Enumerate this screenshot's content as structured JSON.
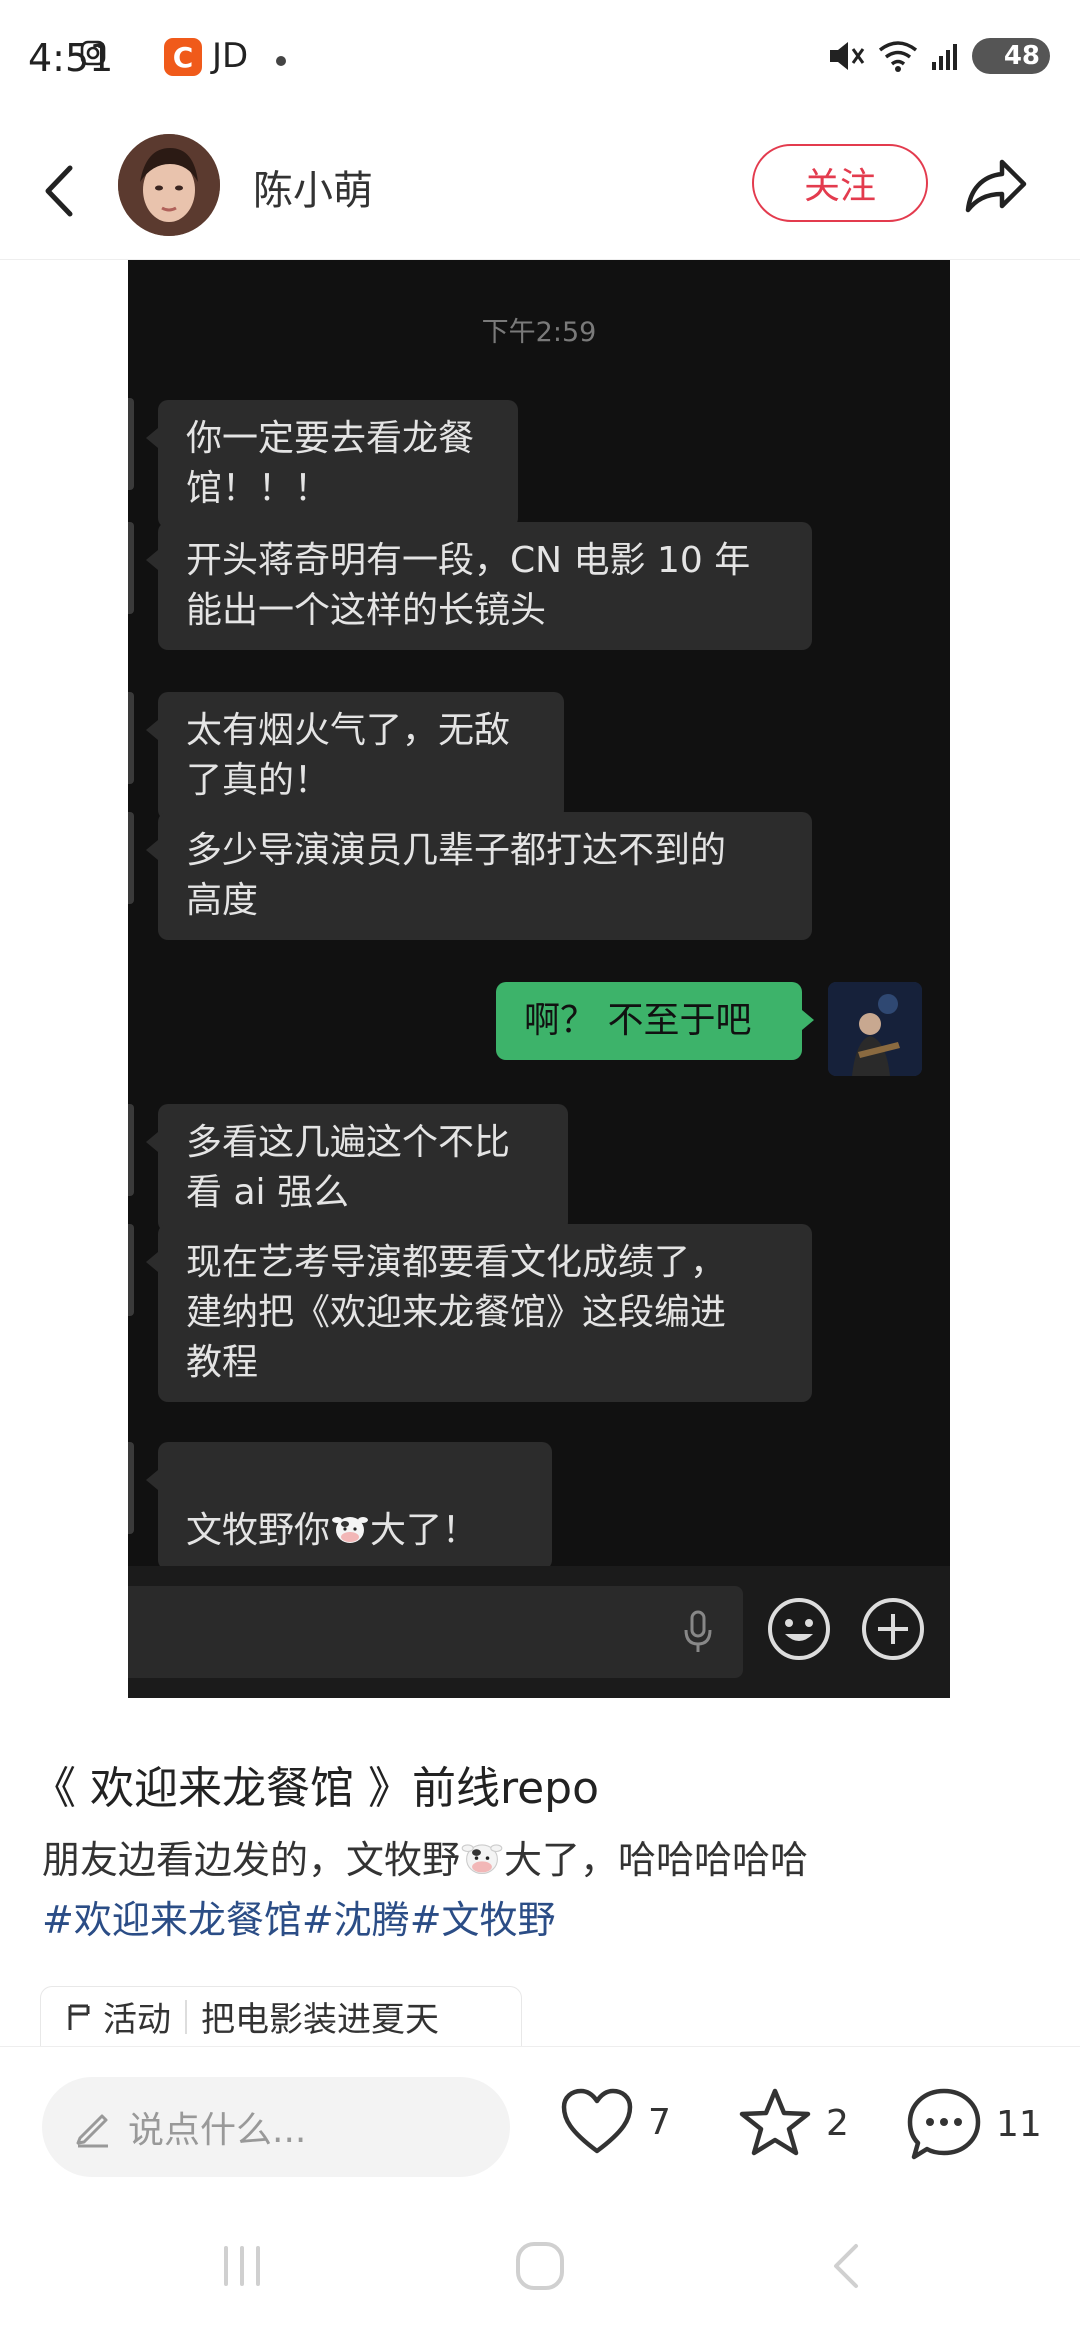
{
  "status_bar": {
    "time": "4:51",
    "app_badge": "C",
    "app_label": "JD",
    "battery": "48"
  },
  "header": {
    "author_name": "陈小萌",
    "follow_label": "关注"
  },
  "chat": {
    "timestamp": "下午2:59",
    "messages": [
      {
        "side": "left",
        "text": "你一定要去看龙餐馆！！！"
      },
      {
        "side": "left",
        "text": "开头蒋奇明有一段，CN 电影 10 年\n能出一个这样的长镜头"
      },
      {
        "side": "left",
        "text": "太有烟火气了，无敌了真的！"
      },
      {
        "side": "left",
        "text": "多少导演演员几辈子都打达不到的\n高度"
      },
      {
        "side": "right",
        "text": "啊？ 不至于吧"
      },
      {
        "side": "left",
        "text": "多看这几遍这个不比看 ai 强么"
      },
      {
        "side": "left",
        "text": "现在艺考导演都要看文化成绩了，\n建纳把《欢迎来龙餐馆》这段编进\n教程"
      },
      {
        "side": "left",
        "text_before": "文牧野你",
        "text_after": "大了！"
      }
    ]
  },
  "post": {
    "title": "《 欢迎来龙餐馆 》前线repo",
    "body_before": "朋友边看边发的，文牧野",
    "body_after": "大了，哈哈哈哈哈",
    "tags": [
      "#欢迎来龙餐馆",
      "#沈腾",
      "#文牧野"
    ],
    "activity_label": "活动",
    "activity_text": "把电影装进夏天"
  },
  "bottom_bar": {
    "comment_placeholder": "说点什么...",
    "likes": "7",
    "stars": "2",
    "comments": "11"
  },
  "icons": {
    "accent": "#e33b4e",
    "tag_color": "#2b4d86",
    "bubble_green": "#3db36a"
  }
}
